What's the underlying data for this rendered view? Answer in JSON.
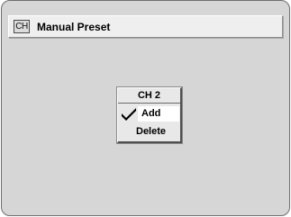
{
  "title_bar": {
    "icon_text": "CH",
    "title": "Manual Preset"
  },
  "menu": {
    "header": "CH  2",
    "options": [
      {
        "label": "Add",
        "selected": true
      },
      {
        "label": "Delete",
        "selected": false
      }
    ],
    "check_icon": "checkmark-icon"
  },
  "colors": {
    "background": "#d6d6d6",
    "title_bar": "#efefef",
    "menu_bg": "#e8e8e8",
    "highlight": "#ffffff"
  }
}
